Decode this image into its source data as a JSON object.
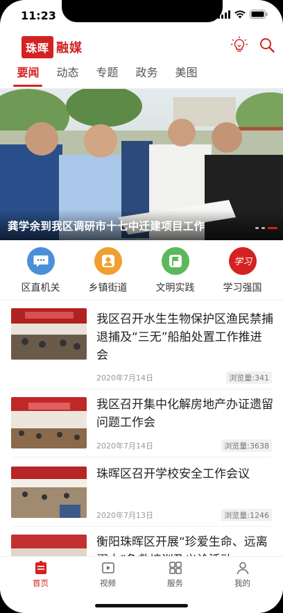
{
  "status": {
    "time": "11:23"
  },
  "header": {
    "logo_box": "珠晖",
    "logo_text": "融媒",
    "icons": [
      "bulb-icon",
      "search-icon"
    ],
    "accent": "#d42222"
  },
  "tabs": [
    {
      "label": "要闻",
      "active": true
    },
    {
      "label": "动态",
      "active": false
    },
    {
      "label": "专题",
      "active": false
    },
    {
      "label": "政务",
      "active": false
    },
    {
      "label": "美图",
      "active": false
    }
  ],
  "banner": {
    "title": "龚学余到我区调研市十七中迁建项目工作",
    "slide_count": 3,
    "active_slide": 3
  },
  "quick_entries": [
    {
      "label": "区直机关",
      "icon": "chat-icon",
      "color": "#4a90d9"
    },
    {
      "label": "乡镇街道",
      "icon": "person-icon",
      "color": "#f0a030"
    },
    {
      "label": "文明实践",
      "icon": "flag-icon",
      "color": "#5cb85c"
    },
    {
      "label": "学习强国",
      "icon": "xuexi-logo-icon",
      "color": "#d42222",
      "logo_text": "学习"
    }
  ],
  "news": [
    {
      "title": "我区召开水生生物保护区渔民禁捕退捕及“三无”船舶处置工作推进会",
      "date": "2020年7月14日",
      "views": "浏览量:341"
    },
    {
      "title": "我区召开集中化解房地产办证遗留问题工作会",
      "date": "2020年7月14日",
      "views": "浏览量:3638"
    },
    {
      "title": "珠晖区召开学校安全工作会议",
      "date": "2020年7月13日",
      "views": "浏览量:1246"
    },
    {
      "title": "衡阳珠晖区开展“珍爱生命、远离溺水”急救培训及义诊活动",
      "date": "",
      "views": ""
    }
  ],
  "bottom_nav": [
    {
      "label": "首页",
      "icon": "home-icon",
      "active": true
    },
    {
      "label": "视频",
      "icon": "video-icon",
      "active": false
    },
    {
      "label": "服务",
      "icon": "grid-icon",
      "active": false
    },
    {
      "label": "我的",
      "icon": "user-icon",
      "active": false
    }
  ]
}
